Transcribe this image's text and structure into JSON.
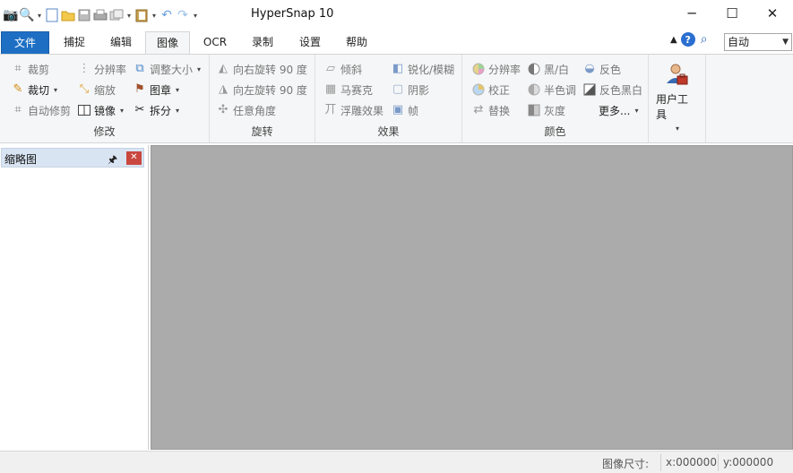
{
  "app": {
    "title": "HyperSnap 10",
    "qat_icons": [
      "camera-icon",
      "magnifier-icon",
      "new-file-icon",
      "open-folder-icon",
      "save-icon",
      "print-icon",
      "copy-icon",
      "clipboard-icon",
      "undo-icon",
      "redo-icon",
      "customize-icon"
    ]
  },
  "tabs": [
    "文件",
    "捕捉",
    "编辑",
    "图像",
    "OCR",
    "录制",
    "设置",
    "帮助"
  ],
  "active_tab": "图像",
  "zoom": {
    "value": "自动"
  },
  "ribbon": {
    "modify": {
      "label": "修改",
      "crop": "裁剪",
      "cut": "裁切",
      "autotrim": "自动修剪",
      "resolution": "分辨率",
      "scale": "缩放",
      "mirror": "镜像",
      "resize": "调整大小",
      "stamp": "图章",
      "split": "拆分"
    },
    "rotate": {
      "label": "旋转",
      "right90": "向右旋转 90 度",
      "left90": "向左旋转 90 度",
      "anyangle": "任意角度"
    },
    "effects": {
      "label": "效果",
      "skew": "倾斜",
      "mosaic": "马赛克",
      "emboss": "浮雕效果",
      "sharpen": "锐化/模糊",
      "shadow": "阴影",
      "frame": "帧"
    },
    "color": {
      "label": "颜色",
      "resolution": "分辨率",
      "correct": "校正",
      "replace": "替换",
      "bw": "黑/白",
      "halftone": "半色调",
      "gray": "灰度",
      "invert": "反色",
      "invertbw": "反色黑白",
      "more": "更多..."
    },
    "usertools": {
      "label": "用户工具"
    }
  },
  "leftpane": {
    "title": "缩略图"
  },
  "status": {
    "size_label": "图像尺寸:",
    "x": "x:000000",
    "y": "y:000000"
  },
  "colors": {
    "accent": "#1e6fc4",
    "workspace": "#ababab",
    "pane_header": "#d8e4f2"
  }
}
